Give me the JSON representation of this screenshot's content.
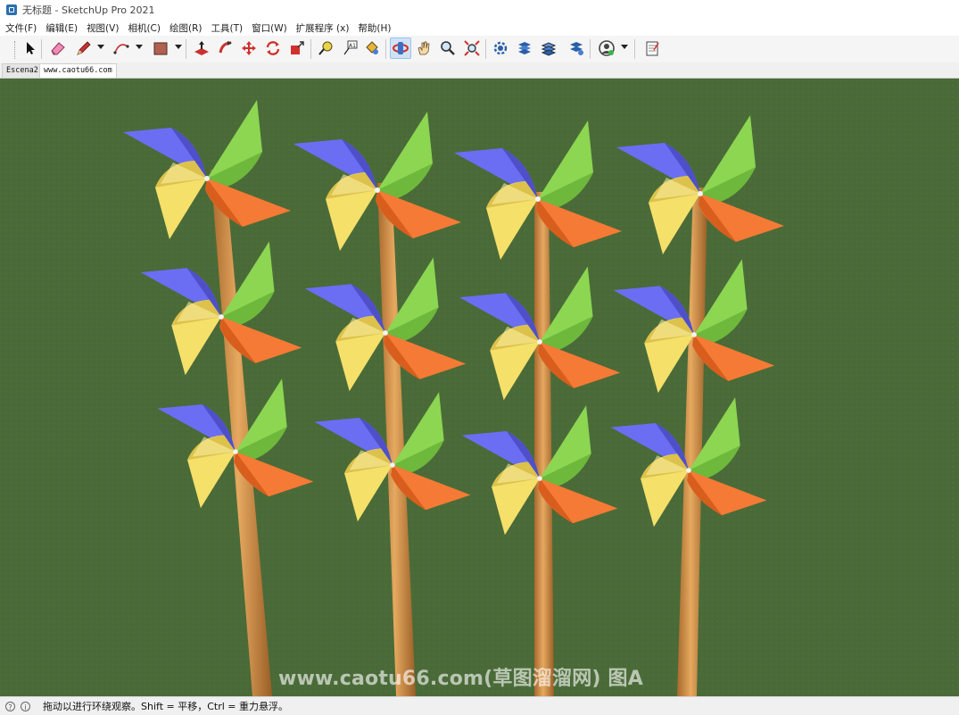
{
  "window": {
    "title": "无标题 - SketchUp Pro 2021"
  },
  "menu": [
    "文件(F)",
    "编辑(E)",
    "视图(V)",
    "相机(C)",
    "绘图(R)",
    "工具(T)",
    "窗口(W)",
    "扩展程序 (x)",
    "帮助(H)"
  ],
  "toolbar": {
    "tools": [
      "select",
      "eraser",
      "line",
      "arc",
      "shape",
      "push-pull",
      "follow-me",
      "move",
      "rotate",
      "scale",
      "tape-measure",
      "text",
      "paint-bucket",
      "orbit",
      "pan",
      "zoom",
      "zoom-extents",
      "section",
      "components",
      "layers",
      "styles",
      "account",
      "layout"
    ],
    "active_tool": "orbit"
  },
  "scene_tabs": [
    "Escena2",
    "www.caotu66.com"
  ],
  "colors": {
    "background": "#4a6b38",
    "blade_blue": "#6b6ef2",
    "blade_green": "#8cd652",
    "blade_orange": "#f57a35",
    "blade_yellow": "#f5e06a",
    "stick": "#d9964a"
  },
  "watermark": "www.caotu66.com(草图溜溜网) 图A",
  "status": {
    "text": "拖动以进行环绕观察。Shift = 平移，Ctrl = 重力悬浮。"
  }
}
